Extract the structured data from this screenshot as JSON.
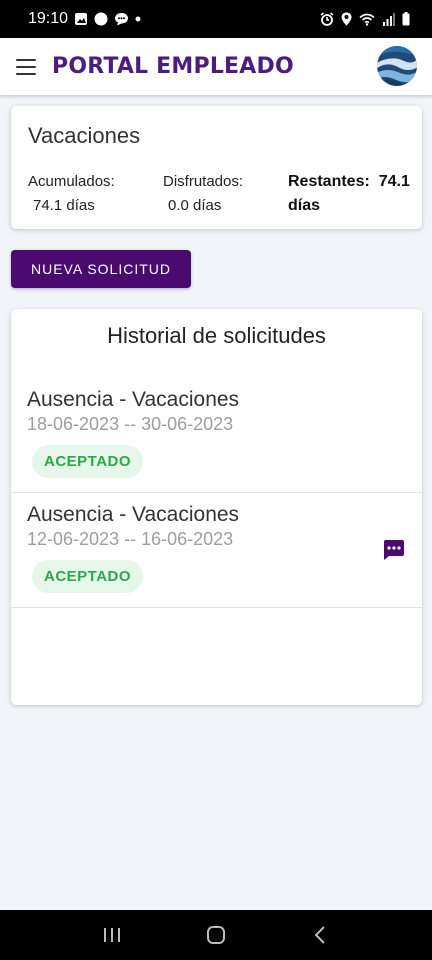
{
  "status_bar": {
    "time": "19:10"
  },
  "app_bar": {
    "title": "PORTAL EMPLEADO"
  },
  "vacations": {
    "title": "Vacaciones",
    "accumulated_label": "Acumulados:",
    "accumulated_value": "74.1 días",
    "enjoyed_label": "Disfrutados:",
    "enjoyed_value": "0.0 días",
    "remaining_label": "Restantes:",
    "remaining_value": "74.1",
    "remaining_unit": "días"
  },
  "new_request_button": "NUEVA SOLICITUD",
  "history": {
    "title": "Historial de solicitudes",
    "requests": [
      {
        "type": "Ausencia - Vacaciones",
        "dates": "18-06-2023 -- 30-06-2023",
        "status": "ACEPTADO",
        "has_comment": false
      },
      {
        "type": "Ausencia - Vacaciones",
        "dates": "12-06-2023 -- 16-06-2023",
        "status": "ACEPTADO",
        "has_comment": true
      }
    ]
  },
  "colors": {
    "brand": "#4a0a6f",
    "accepted_text": "#2aa84a",
    "accepted_bg": "#e6f6ea"
  },
  "icons": [
    "menu-icon",
    "chat-bubble-icon",
    "back-icon",
    "home-icon",
    "recent-apps-icon",
    "wifi-icon",
    "signal-icon",
    "battery-icon",
    "alarm-icon",
    "location-icon"
  ]
}
